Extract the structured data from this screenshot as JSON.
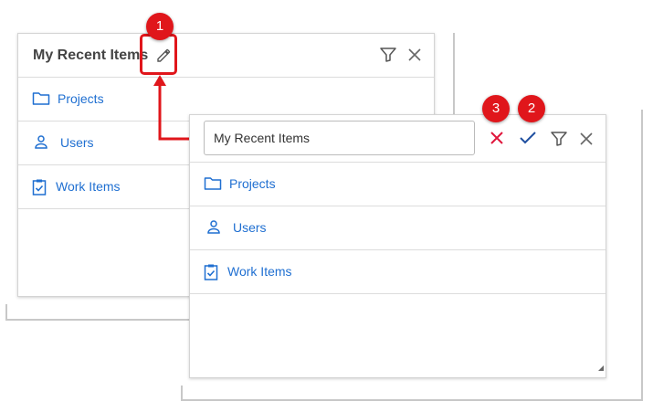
{
  "back_widget": {
    "title": "My Recent Items",
    "header_icons": [
      "pencil-icon",
      "filter-icon",
      "close-icon"
    ],
    "items": [
      {
        "label": "Projects",
        "icon": "folder-icon"
      },
      {
        "label": "Users",
        "icon": "user-icon"
      },
      {
        "label": "Work Items",
        "icon": "clipboard-check-icon"
      }
    ]
  },
  "front_widget": {
    "title_input_value": "My Recent Items",
    "header_icons": [
      "cancel-x-icon",
      "confirm-check-icon",
      "filter-icon",
      "close-icon"
    ],
    "items": [
      {
        "label": "Projects",
        "icon": "folder-icon"
      },
      {
        "label": "Users",
        "icon": "user-icon"
      },
      {
        "label": "Work Items",
        "icon": "clipboard-check-icon"
      }
    ]
  },
  "callouts": {
    "edit": "1",
    "confirm": "2",
    "cancel": "3"
  },
  "colors": {
    "link_blue": "#1f6fd1",
    "callout_red": "#e0161b",
    "cancel_red": "#e0163c",
    "confirm_blue": "#1f4fa0",
    "icon_gray": "#555555"
  }
}
